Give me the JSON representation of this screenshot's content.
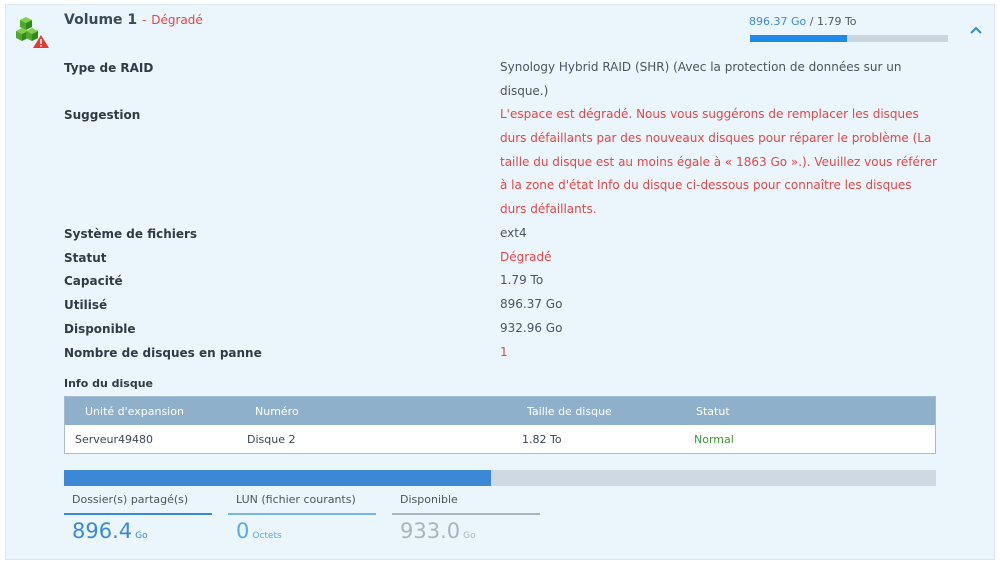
{
  "volume": {
    "title": "Volume 1",
    "separator": "-",
    "status": "Dégradé",
    "used": "896.37 Go",
    "slash": "/",
    "total": "1.79 To",
    "usage_fraction": 0.49,
    "icon": "volume-warning-icon",
    "collapse_icon": "chevron-up-icon"
  },
  "details": {
    "raid_label": "Type de RAID",
    "raid_value": "Synology Hybrid RAID (SHR) (Avec la protection de données sur un disque.)",
    "suggestion_label": "Suggestion",
    "suggestion_value": "L'espace est dégradé. Nous vous suggérons de remplacer les disques durs défaillants par des nouveaux disques pour réparer le problème (La taille du disque est au moins égale à « 1863 Go ».). Veuillez vous référer à la zone d'état Info du disque ci-dessous pour connaître les disques durs défaillants.",
    "fs_label": "Système de fichiers",
    "fs_value": "ext4",
    "status_label": "Statut",
    "status_value": "Dégradé",
    "capacity_label": "Capacité",
    "capacity_value": "1.79 To",
    "used_label": "Utilisé",
    "used_value": "896.37 Go",
    "available_label": "Disponible",
    "available_value": "932.96 Go",
    "failed_label": "Nombre de disques en panne",
    "failed_value": "1"
  },
  "disk_info": {
    "title": "Info du disque",
    "headers": [
      "Unité d'expansion",
      "Numéro",
      "Taille de disque",
      "Statut"
    ],
    "rows": [
      [
        "Serveur49480",
        "Disque 2",
        "1.82 To",
        "Normal"
      ]
    ]
  },
  "usage": {
    "fraction": 0.49,
    "colors": {
      "shared": "#3c88d6",
      "lun": "#74b6e8",
      "available": "#a9b4bd"
    },
    "shared_label": "Dossier(s) partagé(s)",
    "shared_value": "896.4",
    "shared_unit": "Go",
    "lun_label": "LUN (fichier courants)",
    "lun_value": "0",
    "lun_unit": "Octets",
    "available_label": "Disponible",
    "available_value": "933.0",
    "available_unit": "Go"
  }
}
